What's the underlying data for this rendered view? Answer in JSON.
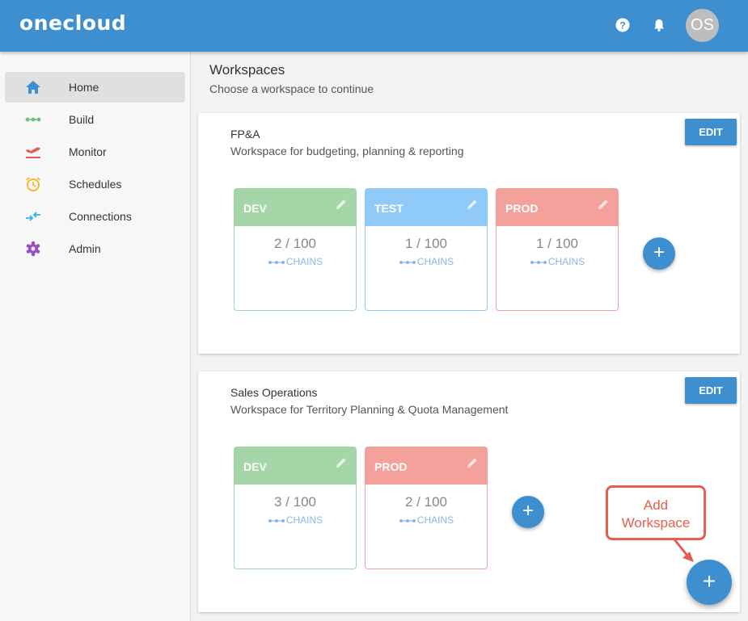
{
  "header": {
    "logo": "onecloud",
    "avatar_initials": "OS",
    "icons": [
      "help-icon",
      "bell-icon"
    ],
    "accent_color": "#3e8fcf"
  },
  "sidebar": {
    "items": [
      {
        "label": "Home",
        "icon": "home-icon",
        "active": true
      },
      {
        "label": "Build",
        "icon": "chain-icon"
      },
      {
        "label": "Monitor",
        "icon": "departure-icon"
      },
      {
        "label": "Schedules",
        "icon": "alarm-clock-icon"
      },
      {
        "label": "Connections",
        "icon": "transfer-arrows-icon"
      },
      {
        "label": "Admin",
        "icon": "gear-icon"
      }
    ]
  },
  "main": {
    "title": "Workspaces",
    "subtitle": "Choose a workspace to continue"
  },
  "workspaces": [
    {
      "name": "FP&A",
      "description": "Workspace for budgeting, planning & reporting",
      "edit_label": "EDIT",
      "environments": [
        {
          "name": "DEV",
          "count": "2 / 100",
          "unit": "CHAINS"
        },
        {
          "name": "TEST",
          "count": "1 / 100",
          "unit": "CHAINS"
        },
        {
          "name": "PROD",
          "count": "1 / 100",
          "unit": "CHAINS"
        }
      ],
      "add_label": "+"
    },
    {
      "name": "Sales Operations",
      "description": "Workspace for Territory Planning & Quota Management",
      "edit_label": "EDIT",
      "environments": [
        {
          "name": "DEV",
          "count": "3 / 100",
          "unit": "CHAINS"
        },
        {
          "name": "PROD",
          "count": "2 / 100",
          "unit": "CHAINS"
        }
      ],
      "add_label": "+"
    }
  ],
  "add_workspace": {
    "button_label": "+",
    "callout_line1": "Add",
    "callout_line2": "Workspace"
  },
  "colors": {
    "dev": "#a5d6a7",
    "test": "#90caf9",
    "prod": "#f4a19c",
    "callout": "#e95d51"
  }
}
